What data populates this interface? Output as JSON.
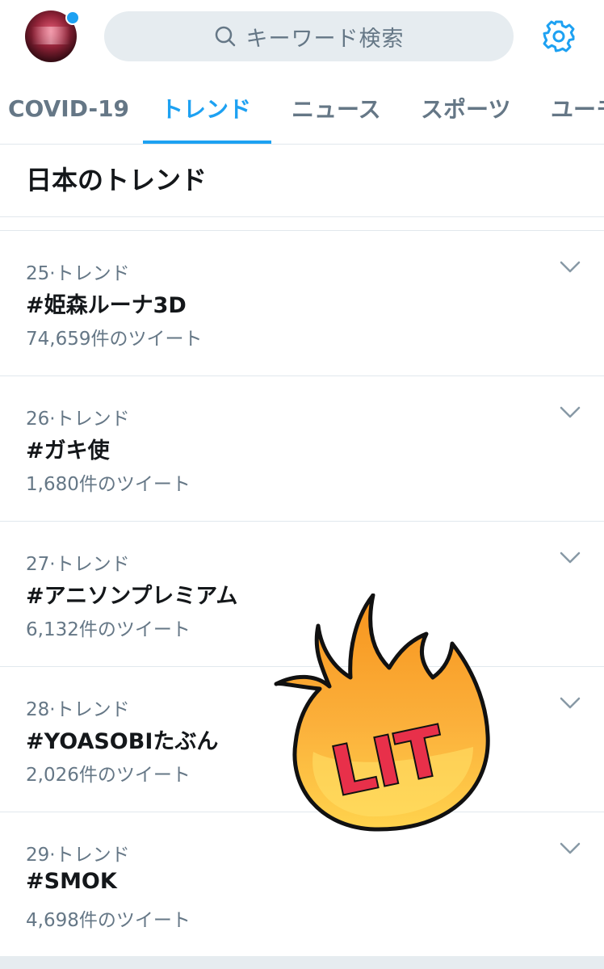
{
  "search": {
    "placeholder": "キーワード検索"
  },
  "tabs": [
    {
      "label": "COVID-19",
      "active": false
    },
    {
      "label": "トレンド",
      "active": true
    },
    {
      "label": "ニュース",
      "active": false
    },
    {
      "label": "スポーツ",
      "active": false
    },
    {
      "label": "ユーモ",
      "active": false
    }
  ],
  "section_title": "日本のトレンド",
  "trends": [
    {
      "meta": "25·トレンド",
      "name": "#姫森ルーナ3D",
      "count": "74,659件のツイート"
    },
    {
      "meta": "26·トレンド",
      "name": "#ガキ使",
      "count": "1,680件のツイート"
    },
    {
      "meta": "27·トレンド",
      "name": "#アニソンプレミアム",
      "count": "6,132件のツイート"
    },
    {
      "meta": "28·トレンド",
      "name": "#YOASOBIたぶん",
      "count": "2,026件のツイート"
    },
    {
      "meta": "29·トレンド",
      "name": "#SMOK",
      "count": "4,698件のツイート"
    }
  ],
  "sticker": {
    "text": "LIT"
  },
  "colors": {
    "accent": "#1da1f2",
    "text_primary": "#14171a",
    "text_secondary": "#657786",
    "divider": "#e1e8ed",
    "search_bg": "#e6ecf0"
  },
  "icons": {
    "search": "search-icon",
    "settings": "gear-icon",
    "trend_menu": "chevron-down-icon"
  }
}
